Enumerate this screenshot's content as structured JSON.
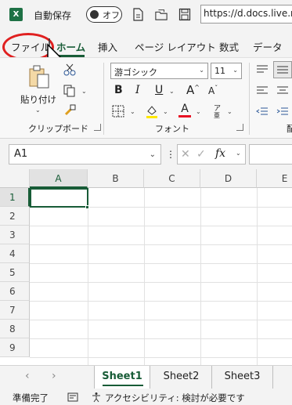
{
  "titlebar": {
    "app_logo": "X",
    "autosave_label": "自動保存",
    "autosave_state": "オフ",
    "url": "https://d.docs.live.n"
  },
  "tabs": {
    "file": "ファイル",
    "home": "ホーム",
    "insert": "挿入",
    "page_layout": "ページ レイアウト",
    "formulas": "数式",
    "data": "データ"
  },
  "ribbon": {
    "paste_label": "貼り付け",
    "clipboard_group": "クリップボード",
    "font_name": "游ゴシック",
    "font_size": "11",
    "font_group": "フォント",
    "bold": "B",
    "italic": "I",
    "underline": "U",
    "grow_font": "A",
    "shrink_font": "A",
    "font_color": "A",
    "phonetic": "ア",
    "truncated_group": "配"
  },
  "formula_bar": {
    "name_box": "A1",
    "fx": "fx"
  },
  "grid": {
    "columns": [
      "A",
      "B",
      "C",
      "D",
      "E"
    ],
    "rows": [
      "1",
      "2",
      "3",
      "4",
      "5",
      "6",
      "7",
      "8",
      "9"
    ],
    "selected_cell": "A1"
  },
  "sheets": [
    "Sheet1",
    "Sheet2",
    "Sheet3"
  ],
  "active_sheet": "Sheet1",
  "status": {
    "ready": "準備完了",
    "accessibility": "アクセシビリティ: 検討が必要です"
  },
  "colors": {
    "excel_green": "#185c37",
    "highlight_circle": "#e02020",
    "font_color_bar": "#e81123",
    "highlight_bar": "#ffe800"
  }
}
